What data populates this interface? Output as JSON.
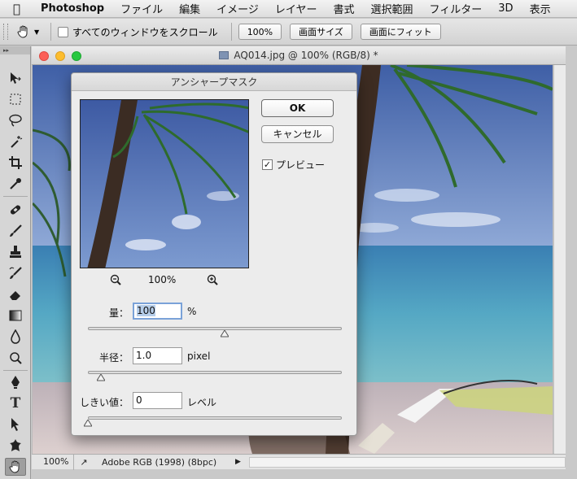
{
  "menubar": {
    "app_name": "Photoshop",
    "items": [
      "ファイル",
      "編集",
      "イメージ",
      "レイヤー",
      "書式",
      "選択範囲",
      "フィルター",
      "3D",
      "表示"
    ]
  },
  "options_bar": {
    "scroll_all_label": "すべてのウィンドウをスクロール",
    "btn_100": "100%",
    "btn_fit_screen": "画面サイズ",
    "btn_fill_screen": "画面にフィット"
  },
  "document": {
    "title": "AQ014.jpg @ 100% (RGB/8) *",
    "zoom": "100%",
    "profile": "Adobe RGB (1998) (8bpc)"
  },
  "dialog": {
    "title": "アンシャープマスク",
    "ok_label": "OK",
    "cancel_label": "キャンセル",
    "preview_label": "プレビュー",
    "preview_checked": true,
    "preview_zoom": "100%",
    "amount": {
      "label": "量：",
      "value": "100",
      "unit": "%",
      "slider_fraction": 0.54
    },
    "radius": {
      "label": "半径：",
      "value": "1.0",
      "unit": "pixel",
      "slider_fraction": 0.05
    },
    "threshold": {
      "label": "しきい値：",
      "value": "0",
      "unit": "レベル",
      "slider_fraction": 0.0
    }
  },
  "colors": {
    "sky": "#4f6fb0",
    "sea": "#4f9bb8",
    "sand": "#cfc3c4",
    "dialog_bg": "#ececec",
    "focus_ring": "#7aa2d8"
  },
  "icons": [
    "apple-icon",
    "hand-icon",
    "move-icon",
    "marquee-icon",
    "lasso-icon",
    "magic-wand-icon",
    "crop-icon",
    "eyedropper-icon",
    "healing-brush-icon",
    "brush-icon",
    "clone-stamp-icon",
    "history-brush-icon",
    "eraser-icon",
    "gradient-icon",
    "blur-icon",
    "dodge-icon",
    "pen-icon",
    "type-icon",
    "path-selection-icon",
    "shape-icon",
    "zoom-out-icon",
    "zoom-in-icon"
  ]
}
